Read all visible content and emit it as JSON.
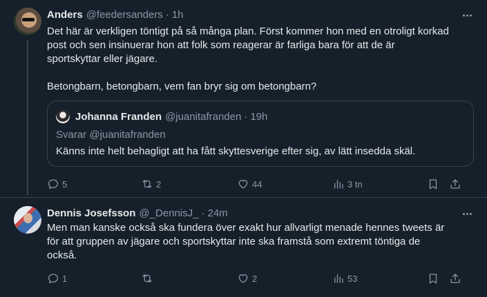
{
  "tweets": [
    {
      "author": "Anders",
      "handle": "@feedersanders",
      "separator": "·",
      "time": "1h",
      "text_lines": [
        "Det här är verkligen töntigt på så många plan. Först kommer hon med en otroligt korkad",
        "post och sen insinuerar hon att folk som reagerar är farliga bara för att de är",
        "sportskyttar eller jägare."
      ],
      "text_paragraph2": "Betongbarn, betongbarn, vem fan bryr sig om betongbarn?",
      "quote": {
        "author": "Johanna Franden",
        "handle": "@juanitafranden",
        "separator": "·",
        "time": "19h",
        "reply_to": "Svarar @juanitafranden",
        "text": "Känns inte helt behagligt att ha fått skyttesverige efter sig, av lätt insedda skäl."
      },
      "actions": {
        "replies": "5",
        "retweets": "2",
        "likes": "44",
        "views": "3 tn"
      }
    },
    {
      "author": "Dennis Josefsson",
      "handle": "@_DennisJ_",
      "separator": "·",
      "time": "24m",
      "text_lines": [
        "Men man kanske också ska fundera över exakt hur allvarligt menade hennes tweets är",
        "för att gruppen av jägare och sportskyttar inte ska framstå som extremt töntiga de",
        "också."
      ],
      "actions": {
        "replies": "1",
        "retweets": "",
        "likes": "2",
        "views": "53"
      }
    }
  ],
  "icons": {
    "reply": "reply-icon",
    "retweet": "retweet-icon",
    "like": "heart-icon",
    "views": "views-icon",
    "bookmark": "bookmark-icon",
    "share": "share-icon",
    "more": "more-icon"
  },
  "colors": {
    "background": "#15202b",
    "text": "#e7e9ea",
    "muted": "#8b98a5",
    "border": "#38444d"
  }
}
